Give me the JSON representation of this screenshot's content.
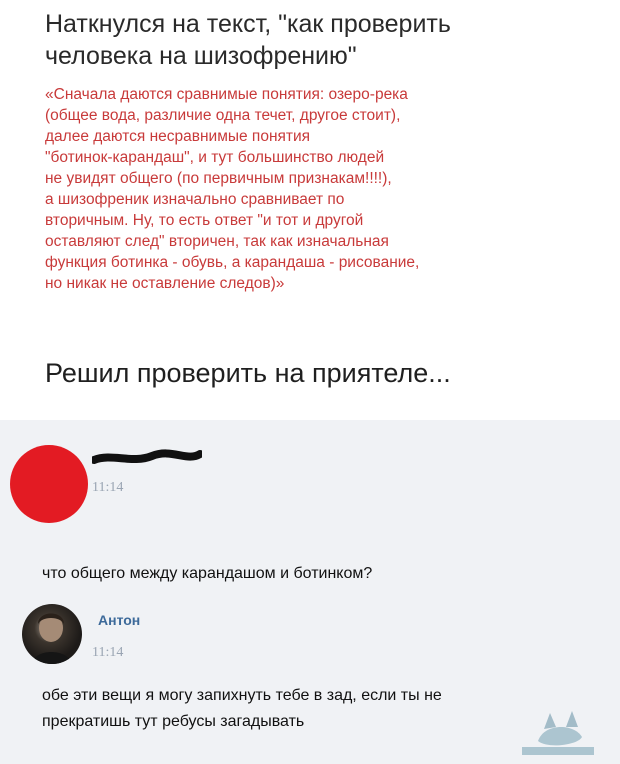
{
  "headline": [
    "Наткнулся на  текст, \"как проверить",
    "человека на шизофрению\""
  ],
  "quote_lines": [
    "«Сначала даются сравнимые понятия: озеро-река",
    "(общее вода, различие одна течет, другое стоит),",
    "далее даются несравнимые понятия",
    "\"ботинок-карандаш\", и тут большинство людей",
    "не увидят общего (по первичным признакам!!!!),",
    "а шизофреник изначально сравнивает по",
    "вторичным. Ну, то есть ответ \"и тот и другой",
    "оставляют след\" вторичен, так как изначальная",
    "функция ботинка - обувь, а карандаша - рисование,",
    "но никак не оставление следов)»"
  ],
  "decision": "Решил проверить на приятеле...",
  "chat": {
    "message1": {
      "time": "11:14",
      "text": "что общего между карандашом и ботинком?"
    },
    "message2": {
      "author": "Антон",
      "time": "11:14",
      "lines": [
        "обе эти вещи я могу запихнуть тебе в зад, если ты не",
        "прекратишь тут ребусы загадывать"
      ]
    }
  },
  "colors": {
    "quote": "#c83a3a",
    "name": "#3d6a9a",
    "avatar_red": "#e31b23",
    "chat_bg": "#f0f2f5"
  }
}
